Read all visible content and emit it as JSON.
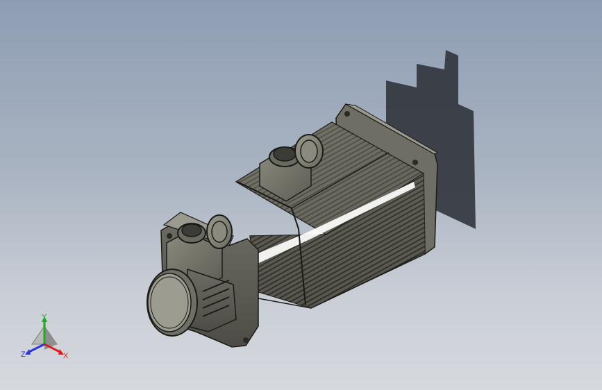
{
  "viewport": {
    "background_top": "#8e9db3",
    "background_bottom": "#d6d9de"
  },
  "model": {
    "body_color": "#7c7c70",
    "edge_color": "#1a1a18",
    "highlight_color": "#ffffff",
    "shadow_color": "#3a3d44"
  },
  "triad": {
    "x_label": "X",
    "y_label": "Y",
    "z_label": "Z",
    "x_color": "#d42020",
    "y_color": "#21a821",
    "z_color": "#2a34d8"
  }
}
